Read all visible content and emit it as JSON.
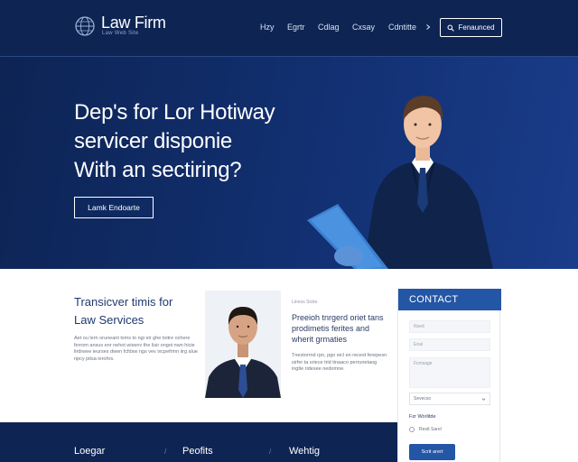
{
  "header": {
    "brand": "Law Firm",
    "brand_sub": "Law Web Site",
    "logo_icon": "globe-icon",
    "nav": [
      "Hzy",
      "Egrtr",
      "Cdlag",
      "Cxsay",
      "Cdntitte"
    ],
    "cta_label": "Fenaunced",
    "cta_icon": "search-icon"
  },
  "hero": {
    "headline": [
      "Dep's for Lor Hotiway",
      "servicer disponie",
      "With an sectiring?"
    ],
    "button": "Lamk Endoarte"
  },
  "services": {
    "title": [
      "Transicver timis for",
      "Law Services"
    ],
    "text": "Aet ou lern oruneant tsms to ngi eir ghe toitre ochere ferrom ansus enr nehot wisenv the lisir ongoi nwn hicie lirdrwee ieurses dwen fcfdsw ngs vev ixcpefrmn iirg alue npcy pitsa ierohrs."
  },
  "profile_card": {
    "small_label": "Linnos  Sicite",
    "title": "Preeioh tnrgerd oriet tans prodimetis ferites and wherit grmaties",
    "text": "Tnestorrnd rpn, pgo eicl en recest ferepesn sirfer ta sriece trid tinaaco perrunetaog ingtle ridesee nedomne."
  },
  "contact": {
    "heading": "CONTACT",
    "fields": [
      "Nsed",
      "Enal"
    ],
    "message_placeholder": "Fcmsage",
    "select_value": "Sevecso",
    "label": "Fzr Worlitde",
    "radio_label": "Restt  Sarel",
    "submit": "Scrit arert"
  },
  "footer": {
    "items": [
      "Loegar",
      "Peofits",
      "Wehtig"
    ]
  },
  "colors": {
    "navy": "#0e2553",
    "accent_blue": "#2456a6",
    "title_blue": "#1e3a6e"
  }
}
